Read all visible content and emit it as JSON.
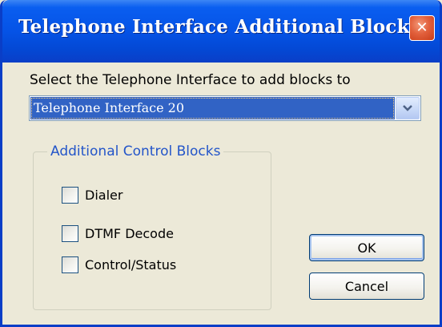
{
  "window": {
    "title": "Telephone Interface Additional Blocks",
    "close_symbol": "✕"
  },
  "prompt": {
    "label": "Select the Telephone Interface to add blocks to"
  },
  "interface_select": {
    "selected_value": "Telephone Interface 20",
    "arrow_icon": "chevron-down-icon"
  },
  "control_blocks": {
    "legend": "Additional Control Blocks",
    "items": [
      {
        "label": "Dialer",
        "checked": false
      },
      {
        "label": "DTMF Decode",
        "checked": false
      },
      {
        "label": "Control/Status",
        "checked": false
      }
    ]
  },
  "buttons": {
    "ok_label": "OK",
    "cancel_label": "Cancel"
  },
  "colors": {
    "titlebar": "#0553e6",
    "selection": "#3163c5",
    "group_legend": "#2355c9",
    "close_button": "#e2603c"
  }
}
